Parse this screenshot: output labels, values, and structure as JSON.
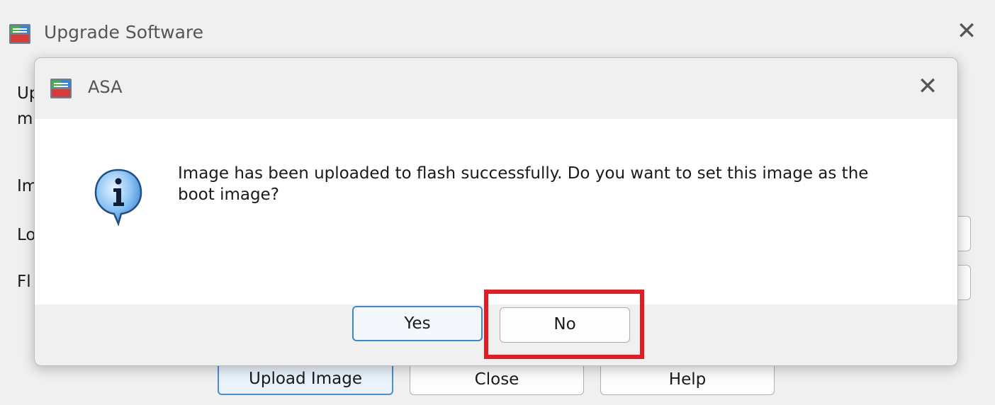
{
  "background_window": {
    "title": "Upgrade Software",
    "close_glyph": "✕",
    "app_icon": "asdm-app-icon",
    "text_fragments": [
      "Up",
      "mi",
      "Im",
      "Lo",
      "Fl"
    ],
    "buttons": {
      "upload_label": "Upload Image",
      "close_label": "Close",
      "help_label": "Help"
    }
  },
  "dialog": {
    "title": "ASA",
    "close_glyph": "✕",
    "app_icon": "asdm-app-icon",
    "icon": "info-icon",
    "message": "Image has been uploaded to flash successfully. Do you want to set this image as the boot image?",
    "yes_label": "Yes",
    "no_label": "No"
  },
  "colors": {
    "highlight": "#e31b23",
    "primary_border": "#3d87cf"
  }
}
